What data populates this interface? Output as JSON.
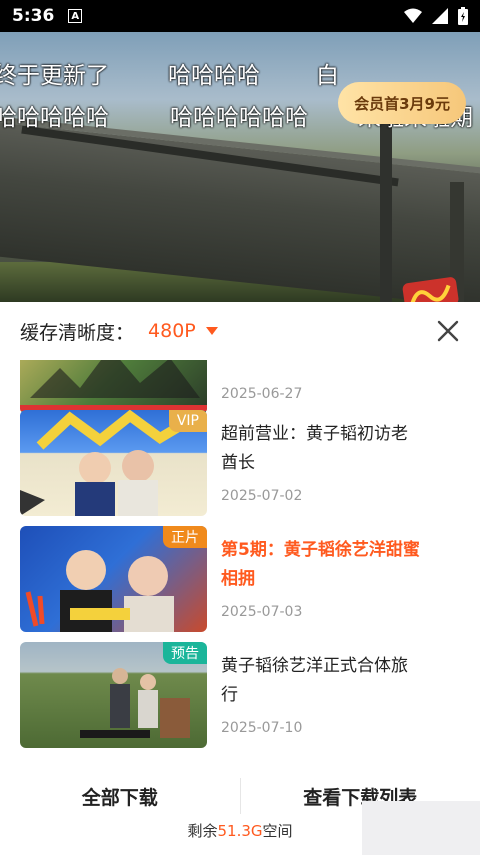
{
  "status_bar": {
    "time": "5:36",
    "notification_letter": "A"
  },
  "video": {
    "danmaku": [
      "终于更新了",
      "哈哈哈哈",
      "白",
      "哈哈哈哈哈",
      "哈哈哈哈哈哈",
      "来啦来啦期"
    ],
    "vip_promo": "会员首3月9元"
  },
  "sheet": {
    "resolution_label": "缓存清晰度：",
    "resolution_value": "480P"
  },
  "episodes": [
    {
      "title": "",
      "date": "2025-06-27",
      "badge": ""
    },
    {
      "title": "超前营业：黄子韬初访老酋长",
      "date": "2025-07-02",
      "badge": "VIP",
      "badge_color": "#e9b04a"
    },
    {
      "title": "第5期：黄子韬徐艺洋甜蜜相拥",
      "date": "2025-07-03",
      "badge": "正片",
      "badge_color": "#f08a1c",
      "playing": true
    },
    {
      "title": "黄子韬徐艺洋正式合体旅行",
      "date": "2025-07-10",
      "badge": "预告",
      "badge_color": "#1bb59a"
    }
  ],
  "footer": {
    "download_all": "全部下载",
    "view_list": "查看下载列表",
    "storage_prefix": "剩余",
    "storage_value": "51.3G",
    "storage_suffix": "空间"
  },
  "colors": {
    "accent": "#ff5a1f"
  }
}
